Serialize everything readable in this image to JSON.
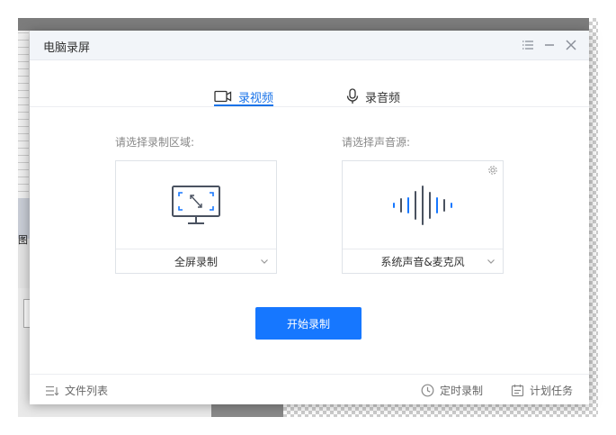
{
  "background": {
    "left_label": "图"
  },
  "window": {
    "title": "电脑录屏",
    "controls": [
      "menu-icon",
      "minimize-icon",
      "close-icon"
    ]
  },
  "tabs": [
    {
      "label": "录视频",
      "icon": "video-camera-icon",
      "active": true
    },
    {
      "label": "录音频",
      "icon": "microphone-icon",
      "active": false
    }
  ],
  "region": {
    "label": "请选择录制区域:",
    "selected": "全屏录制",
    "icon": "fullscreen-monitor-icon"
  },
  "audio": {
    "label": "请选择声音源:",
    "selected": "系统声音&麦克风",
    "icon": "sound-wave-icon"
  },
  "start_button": "开始录制",
  "footer": {
    "file_list": "文件列表",
    "timed_record": "定时录制",
    "scheduled_tasks": "计划任务"
  },
  "colors": {
    "accent": "#1677ff",
    "tab_active": "#1a73e8",
    "icon_gray": "#5b6470"
  }
}
